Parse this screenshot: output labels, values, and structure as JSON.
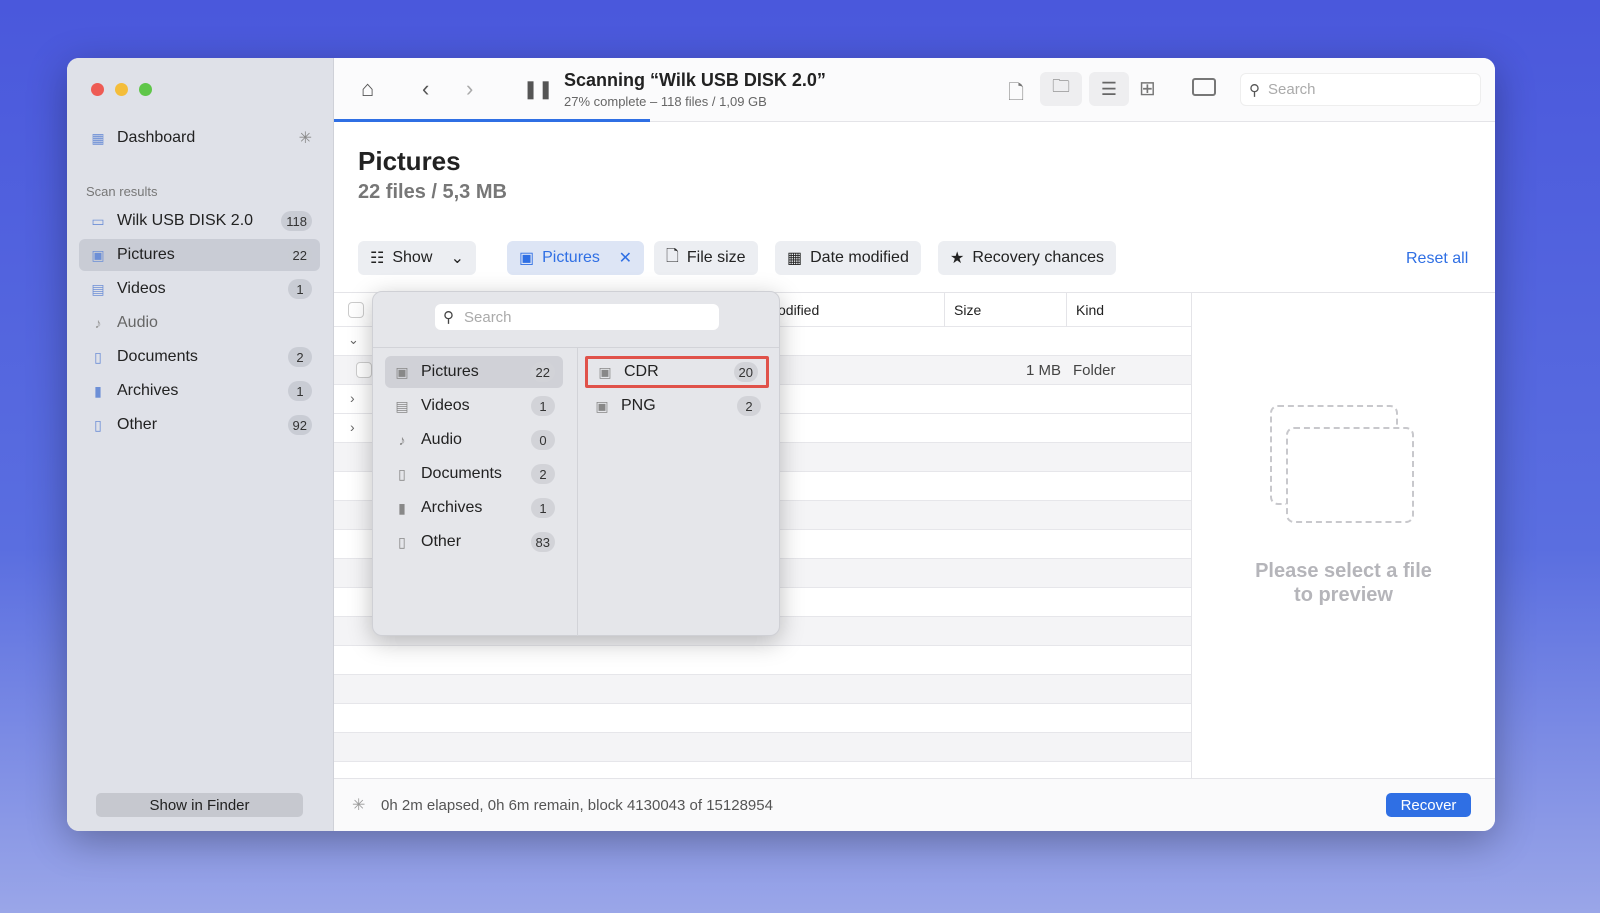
{
  "sidebar": {
    "dashboard": "Dashboard",
    "section": "Scan results",
    "items": [
      {
        "label": "Wilk USB DISK 2.0",
        "count": "118",
        "icon": "drive-icon"
      },
      {
        "label": "Pictures",
        "count": "22",
        "icon": "image-icon"
      },
      {
        "label": "Videos",
        "count": "1",
        "icon": "film-icon"
      },
      {
        "label": "Audio",
        "count": "",
        "icon": "music-icon"
      },
      {
        "label": "Documents",
        "count": "2",
        "icon": "document-icon"
      },
      {
        "label": "Archives",
        "count": "1",
        "icon": "archive-icon"
      },
      {
        "label": "Other",
        "count": "92",
        "icon": "other-icon"
      }
    ],
    "show_in_finder": "Show in Finder"
  },
  "toolbar": {
    "title": "Scanning “Wilk USB DISK 2.0”",
    "subtitle": "27% complete – 118 files / 1,09 GB",
    "progress": 27,
    "search_placeholder": "Search"
  },
  "page": {
    "title": "Pictures",
    "subtitle": "22 files / 5,3 MB"
  },
  "filters": {
    "show": "Show",
    "pictures": "Pictures",
    "file_size": "File size",
    "date_modified": "Date modified",
    "recovery": "Recovery chances",
    "reset": "Reset all"
  },
  "table": {
    "headers": {
      "modified": "odified",
      "size": "Size",
      "kind": "Kind"
    },
    "row": {
      "size": "1 MB",
      "kind": "Folder"
    }
  },
  "popup": {
    "search_placeholder": "Search",
    "categories": [
      {
        "label": "Pictures",
        "count": "22"
      },
      {
        "label": "Videos",
        "count": "1"
      },
      {
        "label": "Audio",
        "count": "0"
      },
      {
        "label": "Documents",
        "count": "2"
      },
      {
        "label": "Archives",
        "count": "1"
      },
      {
        "label": "Other",
        "count": "83"
      }
    ],
    "types": [
      {
        "label": "CDR",
        "count": "20"
      },
      {
        "label": "PNG",
        "count": "2"
      }
    ]
  },
  "preview": {
    "text1": "Please select a file",
    "text2": "to preview"
  },
  "status": {
    "text": "0h 2m elapsed, 0h 6m remain, block 4130043 of 15128954",
    "recover": "Recover"
  },
  "colors": {
    "accent": "#2f6fe4",
    "highlight": "#e0524a"
  }
}
